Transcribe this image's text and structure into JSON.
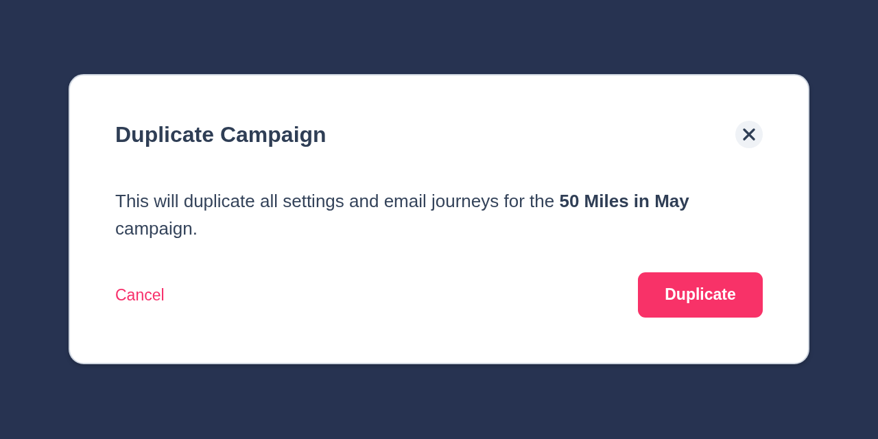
{
  "dialog": {
    "title": "Duplicate Campaign",
    "message": "This will duplicate all settings and email journeys for the **50 Miles in May** campaign.",
    "buttons": [
      {
        "label": "Cancel",
        "kind": "link"
      },
      {
        "label": "Duplicate",
        "kind": "primary"
      }
    ]
  }
}
